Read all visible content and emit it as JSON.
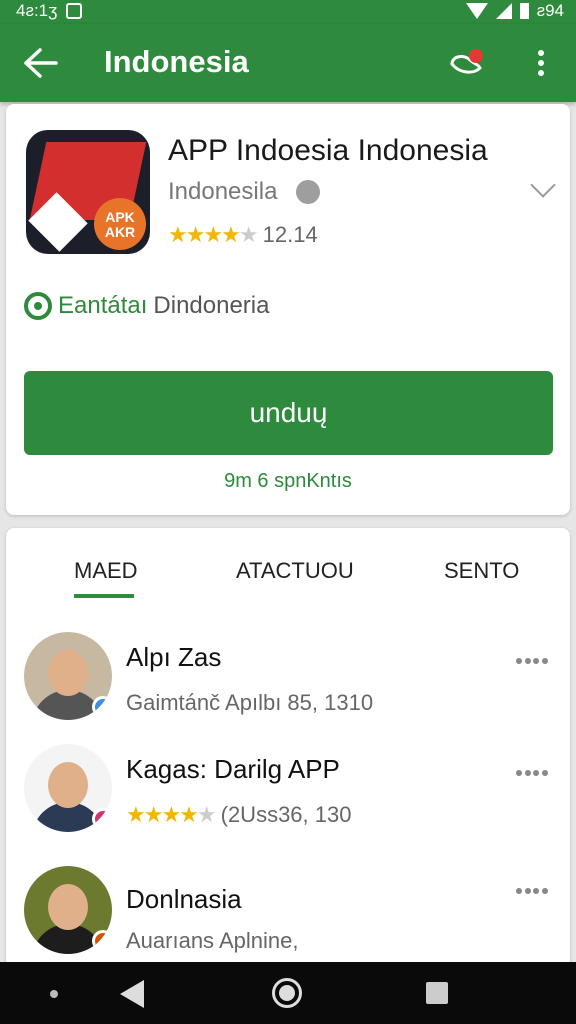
{
  "status": {
    "time": "4ƨ:1ʒ",
    "battery": "ƨ94"
  },
  "appbar": {
    "title": "Indonesia",
    "back_icon": "arrow-back-icon",
    "share_icon": "share-map-icon",
    "menu_icon": "more-vert-icon"
  },
  "app": {
    "title": "APP Indoesia Indonesia",
    "developer": "Indonesila",
    "rating": "12.14",
    "icon_badge": "APK AKR",
    "badge_green": "Eantátaı",
    "badge_gray": "Dindoneria",
    "install_label": "unduų",
    "install_sub": "9m 6 spnKntıs"
  },
  "tabs": [
    "MAED",
    "ATACTUOU",
    "SENTO"
  ],
  "list": [
    {
      "title": "Alpı Zas",
      "sub": "Gaimtánč Apılbı 85, 1310",
      "badge_color": "#3d8fe0"
    },
    {
      "title": "Kagas: Darilg APP",
      "sub": "(2Uss36, 130",
      "badge_color": "#d6336c"
    },
    {
      "title": "Donlnasia",
      "sub": "Auarıans Aplnine,",
      "badge_color": "#d35400"
    }
  ],
  "colors": {
    "primary": "#2e8a3c",
    "star": "#f2b705"
  }
}
